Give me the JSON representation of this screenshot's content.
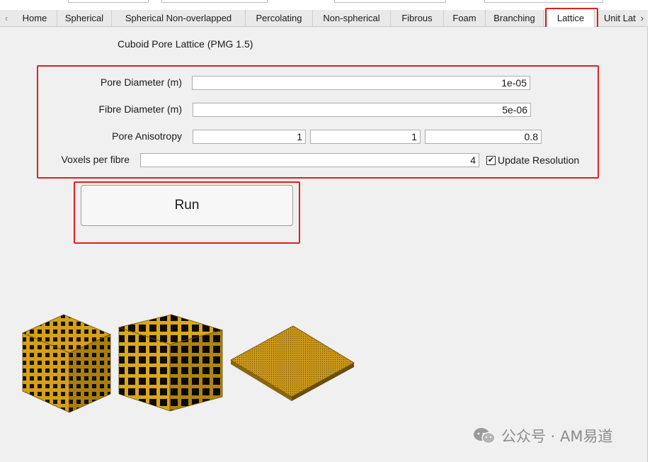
{
  "tabs": [
    {
      "label": "Home"
    },
    {
      "label": "Spherical"
    },
    {
      "label": "Spherical Non-overlapped"
    },
    {
      "label": "Percolating"
    },
    {
      "label": "Non-spherical"
    },
    {
      "label": "Fibrous"
    },
    {
      "label": "Foam"
    },
    {
      "label": "Branching"
    },
    {
      "label": "Lattice"
    },
    {
      "label": "Unit Lat"
    }
  ],
  "active_tab": "Lattice",
  "panel": {
    "title": "Cuboid Pore Lattice (PMG 1.5)",
    "pore_diameter": {
      "label": "Pore Diameter (m)",
      "value": "1e-05"
    },
    "fibre_diameter": {
      "label": "Fibre Diameter (m)",
      "value": "5e-06"
    },
    "pore_anisotropy": {
      "label": "Pore Anisotropy",
      "values": [
        "1",
        "1",
        "0.8"
      ]
    },
    "voxels_per_fibre": {
      "label": "Voxels per fibre",
      "value": "4"
    },
    "update_resolution": {
      "label": "Update Resolution",
      "checked": true
    },
    "run_label": "Run"
  },
  "watermark": {
    "text": "公众号 · AM易道"
  },
  "colors": {
    "highlight": "#e02020",
    "lattice": "#d4a017",
    "panel_bg": "#f0f0f0"
  }
}
